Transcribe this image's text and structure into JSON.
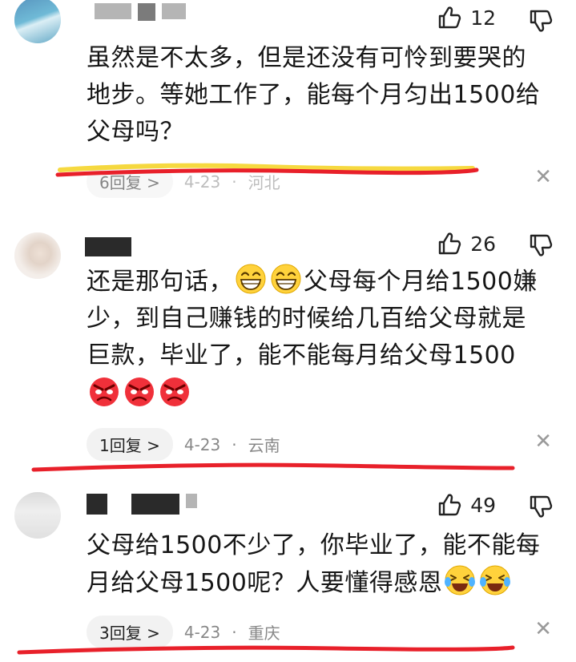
{
  "comments": [
    {
      "likes": "12",
      "text_lines": [
        "虽然是不太多，但是还没有可怜到要哭的",
        "地步。等她工作了，能每个月匀出1500给",
        "父母吗？"
      ],
      "replies": "6回复",
      "date": "4-23",
      "location": "河北"
    },
    {
      "likes": "26",
      "text_part1": "还是那句话，",
      "text_part2": "父母每个月给1500嫌",
      "text_line2": "少，到自己赚钱的时候给几百给父母就是",
      "text_line3": "巨款，毕业了，能不能每月给父母1500",
      "replies": "1回复",
      "date": "4-23",
      "location": "云南"
    },
    {
      "likes": "49",
      "text_line1": "父母给1500不少了，你毕业了，能不能每",
      "text_line2": "月给父母1500呢？人要懂得感恩",
      "replies": "3回复",
      "date": "4-23",
      "location": "重庆"
    }
  ],
  "icons": {
    "like": "thumbs-up-icon",
    "dislike": "thumbs-down-icon",
    "close": "close-icon",
    "chevron": "chevron-right-icon"
  },
  "separator": "·",
  "chevron": ">",
  "close_glyph": "✕",
  "colors": {
    "underline": "#e8202a",
    "highlight": "#f4d21f",
    "meta": "#888888"
  }
}
